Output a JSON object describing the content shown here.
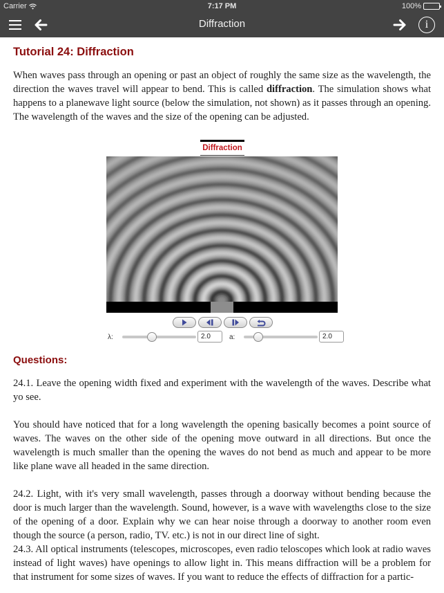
{
  "status_bar": {
    "carrier": "Carrier",
    "time": "7:17 PM",
    "battery": "100%"
  },
  "nav": {
    "title": "Diffraction",
    "info_glyph": "i",
    "icons": [
      "menu-icon",
      "back-arrow-icon",
      "forward-arrow-icon",
      "info-icon"
    ]
  },
  "tutorial": {
    "title": "Tutorial 24: Diffraction",
    "intro_before": "When waves pass through an opening or past an object of roughly the same size as the wavelength, the direction the waves travel will appear to bend. This is called ",
    "intro_bold": "diffraction",
    "intro_after": ". The simulation shows what happens to a planewave light source (below the simulation, not shown) as it passes through an opening. The wavelength of the waves and the size of the opening can be adjusted."
  },
  "simulation": {
    "tab_label": "Diffraction",
    "controls": [
      {
        "name": "play",
        "icon": "play-icon"
      },
      {
        "name": "step-back",
        "icon": "step-back-icon"
      },
      {
        "name": "step-forward",
        "icon": "step-forward-icon"
      },
      {
        "name": "reset",
        "icon": "reset-icon"
      }
    ],
    "lambda": {
      "label": "λ:",
      "value": "2.0",
      "fraction": 0.4
    },
    "aperture": {
      "label": "a:",
      "value": "2.0",
      "fraction": 0.2
    }
  },
  "questions": {
    "heading": "Questions:",
    "items": [
      "24.1. Leave the opening width fixed and experiment with the wavelength of the waves. Describe what yo see.",
      "You should have noticed that for a long wavelength the opening basically becomes a point source of waves. The waves on the other side of the opening move outward in all directions. But once the wavelength is much smaller than the opening the waves do not bend as much and appear to be more like plane wave all headed in the same direction.",
      "24.2. Light, with it's very small wavelength, passes through a doorway without bending because the door is much larger than the wavelength. Sound, however, is a wave with wavelengths close to the size of the opening of a door. Explain why we can hear noise through a doorway to another room even though the source (a person, radio, TV. etc.) is not in our direct line of sight.",
      "24.3. All optical instruments (telescopes, microscopes, even radio teloscopes which look at radio waves instead of light waves) have openings to allow light in. This means diffraction will be a problem for that instrument for some sizes of waves. If you want to reduce the effects of diffraction for a partic-"
    ]
  }
}
